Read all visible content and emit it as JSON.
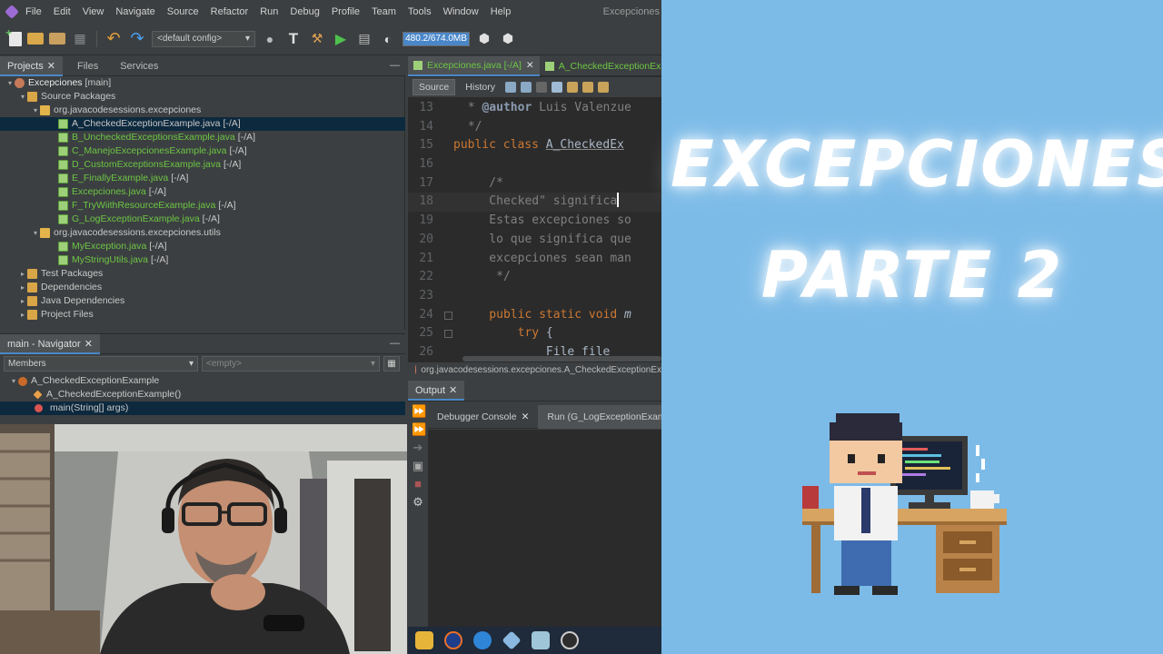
{
  "menubar": {
    "items": [
      "File",
      "Edit",
      "View",
      "Navigate",
      "Source",
      "Refactor",
      "Run",
      "Debug",
      "Profile",
      "Team",
      "Tools",
      "Window",
      "Help"
    ],
    "window_title": "Excepciones"
  },
  "toolbar": {
    "config": "<default config>",
    "memory": "480.2/674.0MB"
  },
  "projects_panel": {
    "tabs": [
      "Projects",
      "Files",
      "Services"
    ],
    "minimize": "—",
    "tree": [
      {
        "label": "Excepciones",
        "suffix": "[main]"
      },
      {
        "label": "Source Packages",
        "suffix": ""
      },
      {
        "label": "org.javacodesessions.excepciones",
        "suffix": ""
      },
      {
        "label": "A_CheckedExceptionExample.java",
        "suffix": "[-/A]"
      },
      {
        "label": "B_UncheckedExceptionsExample.java",
        "suffix": "[-/A]"
      },
      {
        "label": "C_ManejoExcepcionesExample.java",
        "suffix": "[-/A]"
      },
      {
        "label": "D_CustomExceptionsExample.java",
        "suffix": "[-/A]"
      },
      {
        "label": "E_FinallyExample.java",
        "suffix": "[-/A]"
      },
      {
        "label": "Excepciones.java",
        "suffix": "[-/A]"
      },
      {
        "label": "F_TryWiithResourceExample.java",
        "suffix": "[-/A]"
      },
      {
        "label": "G_LogExceptionExample.java",
        "suffix": "[-/A]"
      },
      {
        "label": "org.javacodesessions.excepciones.utils",
        "suffix": ""
      },
      {
        "label": "MyException.java",
        "suffix": "[-/A]"
      },
      {
        "label": "MyStringUtils.java",
        "suffix": "[-/A]"
      },
      {
        "label": "Test Packages",
        "suffix": ""
      },
      {
        "label": "Dependencies",
        "suffix": ""
      },
      {
        "label": "Java Dependencies",
        "suffix": ""
      },
      {
        "label": "Project Files",
        "suffix": ""
      }
    ]
  },
  "navigator": {
    "title": "main - Navigator",
    "filter_members": "Members",
    "filter_empty": "<empty>",
    "items": [
      "A_CheckedExceptionExample",
      "A_CheckedExceptionExample()",
      "main(String[] args)"
    ]
  },
  "editor": {
    "tabs": [
      "Excepciones.java [-/A]",
      "A_CheckedExceptionExam"
    ],
    "source_button": "Source",
    "history_button": "History",
    "breadcrumb": "org.javacodesessions.excepciones.A_CheckedExceptionEx",
    "line_numbers": [
      "13",
      "14",
      "15",
      "16",
      "17",
      "18",
      "19",
      "20",
      "21",
      "22",
      "23",
      "24",
      "25",
      "26"
    ],
    "code": {
      "l13a": " * ",
      "l13b": "@author",
      "l13c": " Luis Valenzue",
      "l14": " */",
      "l15a": "public class ",
      "l15b": "A_CheckedEx",
      "l17": "    /*",
      "l18": "    Checked\" significa",
      "l19": "    Estas excepciones so",
      "l20": "    lo que significa que",
      "l21": "    excepciones sean man",
      "l22": "     */",
      "l24a": "    public static void ",
      "l24b": "m",
      "l25a": "        try",
      "l25b": " {",
      "l26": "            File file"
    }
  },
  "output": {
    "title": "Output",
    "tabs": [
      "Debugger Console",
      "Run (G_LogExceptionExample"
    ]
  },
  "promo": {
    "line1": "EXCEPCIONES",
    "line2": "PARTE 2"
  }
}
